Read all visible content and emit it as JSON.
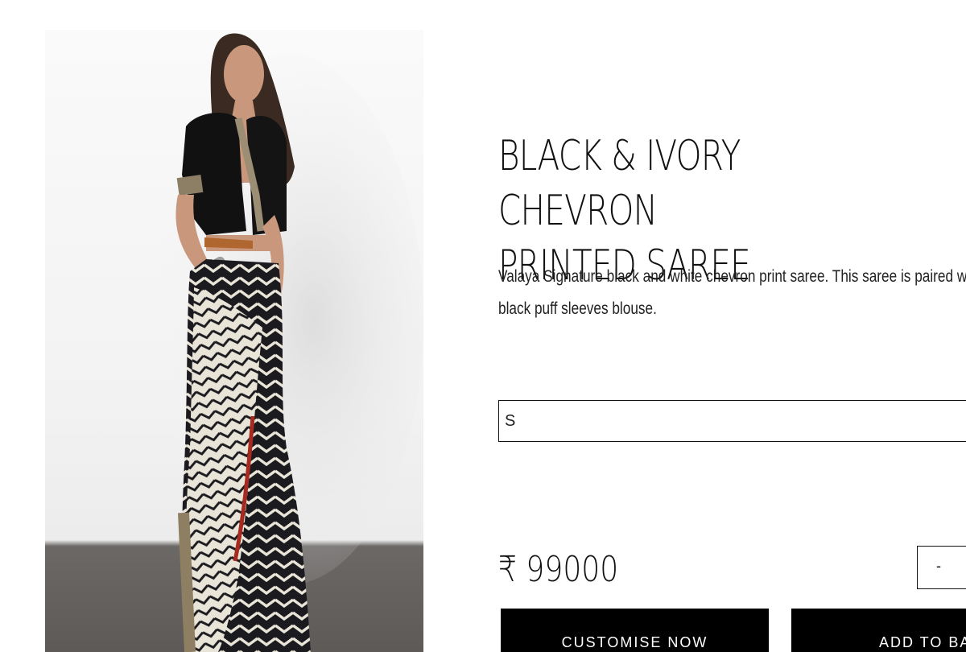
{
  "product": {
    "title": "BLACK & IVORY CHEVRON\nPRINTED SAREE",
    "description": "Valaya Signature black and white chevron print saree. This saree is paired with a black puff sleeves blouse.",
    "price": "₹ 99000",
    "image_alt": "Model wearing black and ivory chevron printed saree with black puff sleeves blouse"
  },
  "options": {
    "size_selected": "S"
  },
  "quantity": {
    "decrement_label": "-"
  },
  "actions": {
    "customise_label": "CUSTOMISE NOW",
    "add_to_bag_label": "ADD TO BAG"
  },
  "colors": {
    "button_bg": "#000000",
    "button_text": "#ffffff",
    "border": "#111111"
  }
}
